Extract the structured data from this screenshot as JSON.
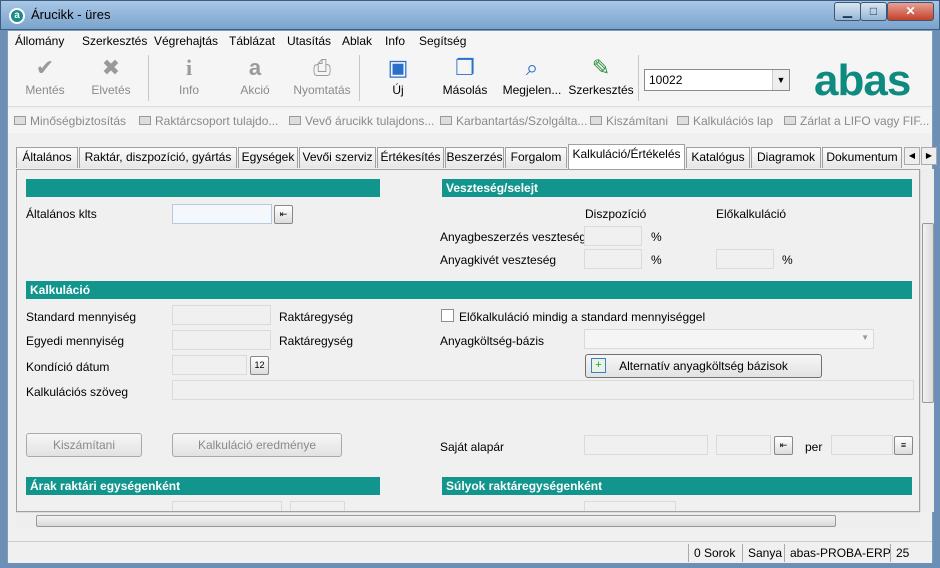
{
  "window": {
    "title": "Árucikk - üres",
    "min": "▁",
    "max": "□",
    "close": "✕"
  },
  "menu": [
    "Állomány",
    "Szerkesztés",
    "Végrehajtás",
    "Táblázat",
    "Utasítás",
    "Ablak",
    "Info",
    "Segítség"
  ],
  "toolbar": {
    "save": "Mentés",
    "discard": "Elvetés",
    "info": "Info",
    "action": "Akció",
    "print": "Nyomtatás",
    "new": "Új",
    "copy": "Másolás",
    "view": "Megjelen...",
    "edit": "Szerkesztés",
    "combo_value": "10022"
  },
  "logo": "abas",
  "links": [
    "Minőségbiztosítás",
    "Raktárcsoport tulajdo...",
    "Vevő árucikk tulajdons...",
    "Karbantartás/Szolgálta...",
    "Kiszámítani",
    "Kalkulációs lap",
    "Zárlat a LIFO vagy FIF..."
  ],
  "tabs": [
    "Általános",
    "Raktár, diszpozíció, gyártás",
    "Egységek",
    "Vevői szerviz",
    "Értékesítés",
    "Beszerzés",
    "Forgalom",
    "Kalkuláció/Értékelés",
    "Katalógus",
    "Diagramok",
    "Dokumentum"
  ],
  "form": {
    "loss_header": "Veszteség/selejt",
    "general_costs": "Általános klts",
    "col_dispo": "Diszpozíció",
    "col_precalc": "Előkalkuláció",
    "purchase_loss": "Anyagbeszerzés veszteség",
    "issue_loss": "Anyagkivét veszteség",
    "percent": "%",
    "calc_header": "Kalkuláció",
    "std_qty": "Standard mennyiség",
    "single_qty": "Egyedi mennyiség",
    "stock_unit": "Raktáregység",
    "cond_date": "Kondíció dátum",
    "calc_text": "Kalkulációs szöveg",
    "precalc_check": "Előkalkuláció mindig a standard mennyiséggel",
    "cost_base": "Anyagköltség-bázis",
    "alt_btn": "Alternatív anyagköltség bázisok",
    "calc_btn": "Kiszámítani",
    "result_btn": "Kalkuláció eredménye",
    "own_price": "Saját alapár",
    "per": "per",
    "prices_header": "Árak raktári egységenként",
    "weights_header": "Súlyok raktáregységenként"
  },
  "status": {
    "rows": "0 Sorok",
    "user": "Sanya",
    "db": "abas-PROBA-ERP",
    "num": "25"
  }
}
